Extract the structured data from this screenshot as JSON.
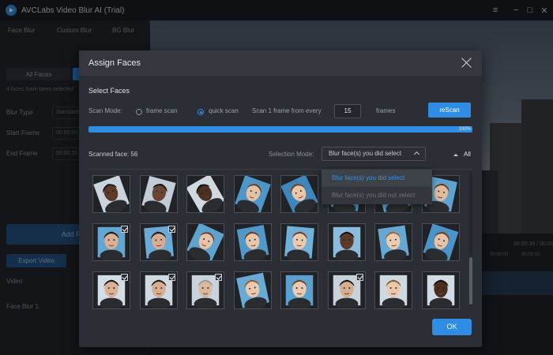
{
  "app": {
    "title": "AVCLabs Video Blur AI (Trial)"
  },
  "window_controls": {
    "menu": "≡",
    "minimize": "−",
    "maximize": "□",
    "close": "✕"
  },
  "left_panel": {
    "tabs": [
      "Face Blur",
      "Custom Blur",
      "BG Blur"
    ],
    "segment": "All Faces",
    "note": "4 faces have been selected",
    "rows": [
      {
        "label": "Blur Type",
        "value": "Standard"
      },
      {
        "label": "Start Frame",
        "value": "00:00:00"
      },
      {
        "label": "End Frame",
        "value": "00:00:30"
      }
    ],
    "add_face": "Add Face",
    "export": "Export Video",
    "video_label": "Video",
    "face_blur_label": "Face Blur 1"
  },
  "timeline": {
    "time": "00:00:30 / 00:00:30",
    "ticks": [
      "00:00:00",
      "00:00:10",
      "00:00:20"
    ]
  },
  "dialog": {
    "title": "Assign Faces",
    "section": "Select Faces",
    "scan_mode_label": "Scan Mode:",
    "frame_scan": "frame scan",
    "quick_scan": "quick scan",
    "scan_every": "Scan 1 frame from every",
    "frames_value": "15",
    "frames_label": "frames",
    "rescan": "reScan",
    "progress": {
      "percent": 100,
      "label": "100%"
    },
    "scanned": "Scanned face: 56",
    "selection_mode_label": "Selection Mode:",
    "selection_value": "Blur face(s) you did select",
    "all_label": "All",
    "dropdown_options": [
      "Blur face(s) you did select",
      "Blur face(s) you did not select"
    ],
    "ok": "OK"
  },
  "faces": [
    {
      "skin": "#5b3a27",
      "hair": "#151515",
      "bg": "#c9d4de",
      "tilt": -20,
      "checked": false
    },
    {
      "skin": "#6a4530",
      "hair": "#141414",
      "bg": "#c2ccd6",
      "tilt": 15,
      "checked": false
    },
    {
      "skin": "#4a3022",
      "hair": "#101010",
      "bg": "#d0d8e0",
      "tilt": -30,
      "checked": false
    },
    {
      "skin": "#e4c2a6",
      "hair": "#6b3b22",
      "bg": "#4d96c9",
      "tilt": 20,
      "checked": false
    },
    {
      "skin": "#e8c6aa",
      "hair": "#70411f",
      "bg": "#3f86bd",
      "tilt": -25,
      "checked": false
    },
    {
      "skin": "#e2bfa3",
      "hair": "#6b3b22",
      "bg": "#4a93c6",
      "tilt": 10,
      "checked": false
    },
    {
      "skin": "#e1bea2",
      "hair": "#6b3b22",
      "bg": "#5aa1cf",
      "tilt": -15,
      "checked": false
    },
    {
      "skin": "#e0bc9f",
      "hair": "#6a3a20",
      "bg": "#5fa4d0",
      "tilt": 12,
      "checked": false
    },
    {
      "skin": "#d9b093",
      "hair": "#1a1a1a",
      "bg": "#62a7d4",
      "tilt": 0,
      "checked": true
    },
    {
      "skin": "#d8ad8f",
      "hair": "#1c1c1c",
      "bg": "#6aaad6",
      "tilt": -5,
      "checked": true
    },
    {
      "skin": "#e6c4a8",
      "hair": "#6b3b22",
      "bg": "#5ea3cf",
      "tilt": 25,
      "checked": false
    },
    {
      "skin": "#e7c6aa",
      "hair": "#6e3e22",
      "bg": "#4f98c8",
      "tilt": -10,
      "checked": false
    },
    {
      "skin": "#ebcbb0",
      "hair": "#6f4124",
      "bg": "#71b0d9",
      "tilt": 5,
      "checked": false
    },
    {
      "skin": "#5a3a28",
      "hair": "#131313",
      "bg": "#8cbcdd",
      "tilt": 0,
      "checked": false
    },
    {
      "skin": "#ecccb1",
      "hair": "#9a6a3e",
      "bg": "#66a8d4",
      "tilt": -8,
      "checked": false
    },
    {
      "skin": "#e5c3a7",
      "hair": "#6b3b22",
      "bg": "#4a94c7",
      "tilt": 18,
      "checked": false
    },
    {
      "skin": "#d9b194",
      "hair": "#1a1a1a",
      "bg": "#d3dde6",
      "tilt": 0,
      "checked": true
    },
    {
      "skin": "#d6ad90",
      "hair": "#1d1d1d",
      "bg": "#cfd9e2",
      "tilt": 0,
      "checked": true
    },
    {
      "skin": "#d8b89e",
      "hair": "#9c9c9c",
      "bg": "#c9d3dc",
      "tilt": 0,
      "checked": true
    },
    {
      "skin": "#ebc9ad",
      "hair": "#8a5a34",
      "bg": "#6aabd6",
      "tilt": -12,
      "checked": false
    },
    {
      "skin": "#ebcbb0",
      "hair": "#6f4124",
      "bg": "#5aa1cf",
      "tilt": 0,
      "checked": false
    },
    {
      "skin": "#d7ad90",
      "hair": "#171717",
      "bg": "#c8d2db",
      "tilt": 0,
      "checked": true
    },
    {
      "skin": "#e9c8ac",
      "hair": "#8e5e36",
      "bg": "#cfd9e2",
      "tilt": 0,
      "checked": false
    },
    {
      "skin": "#4a2e1f",
      "hair": "#121212",
      "bg": "#d1dbe3",
      "tilt": 0,
      "checked": false
    }
  ]
}
